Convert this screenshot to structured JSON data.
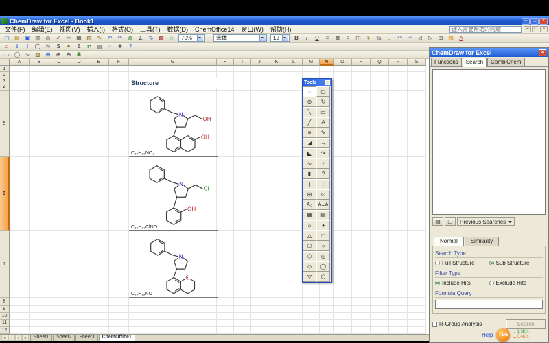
{
  "window": {
    "title": "ChemDraw for Excel - Book1",
    "buttons": [
      {
        "name": "minimize-button",
        "glyph": "─"
      },
      {
        "name": "restore-button",
        "glyph": "□"
      },
      {
        "name": "close-button",
        "glyph": "×",
        "cls": "close"
      }
    ]
  },
  "menu": {
    "items": [
      {
        "name": "menu-file",
        "label": "文件(F)"
      },
      {
        "name": "menu-edit",
        "label": "编辑(E)"
      },
      {
        "name": "menu-view",
        "label": "视图(V)"
      },
      {
        "name": "menu-insert",
        "label": "插入(I)"
      },
      {
        "name": "menu-format",
        "label": "格式(O)"
      },
      {
        "name": "menu-tools",
        "label": "工具(T)"
      },
      {
        "name": "menu-data",
        "label": "数据(D)"
      },
      {
        "name": "menu-chemoffice",
        "label": "ChemOffice14"
      },
      {
        "name": "menu-window",
        "label": "窗口(W)"
      },
      {
        "name": "menu-help",
        "label": "帮助(H)"
      }
    ],
    "help_placeholder": "键入需要帮助的问题",
    "book_controls": [
      {
        "name": "book-minimize-button",
        "glyph": "─"
      },
      {
        "name": "book-restore-button",
        "glyph": "□"
      },
      {
        "name": "book-close-button",
        "glyph": "×"
      }
    ]
  },
  "toolbars": {
    "standard": [
      {
        "name": "new-workbook-icon",
        "glyph": "▢",
        "color": "#2a5bd7"
      },
      {
        "name": "open-icon",
        "glyph": "▤",
        "color": "#b8860b"
      },
      {
        "name": "save-icon",
        "glyph": "▣",
        "color": "#2a5bd7"
      },
      {
        "name": "print-icon",
        "glyph": "▥",
        "color": "#555"
      },
      {
        "name": "print-preview-icon",
        "glyph": "◎",
        "color": "#555"
      },
      {
        "name": "spelling-icon",
        "glyph": "✓",
        "color": "#a33"
      },
      {
        "name": "cut-icon",
        "glyph": "✂",
        "color": "#555"
      },
      {
        "name": "copy-icon",
        "glyph": "▦",
        "color": "#555"
      },
      {
        "name": "paste-icon",
        "glyph": "▧",
        "color": "#8a6d1a"
      },
      {
        "name": "format-painter-icon",
        "glyph": "✎",
        "color": "#8a6d1a"
      },
      {
        "name": "undo-icon",
        "glyph": "↶",
        "color": "#2a5bd7"
      },
      {
        "name": "redo-icon",
        "glyph": "↷",
        "color": "#2a5bd7"
      },
      {
        "name": "hyperlink-icon",
        "glyph": "◍",
        "color": "#2a7a2a"
      },
      {
        "name": "autosum-icon",
        "glyph": "Σ",
        "color": "#333"
      },
      {
        "name": "sort-ascending-icon",
        "glyph": "⇅",
        "color": "#2a5bd7"
      },
      {
        "name": "chart-wizard-icon",
        "glyph": "▩",
        "color": "#a33"
      },
      {
        "name": "drawing-icon",
        "glyph": "◇",
        "color": "#3a7"
      }
    ],
    "zoom_value": "70%",
    "font_name": "宋体",
    "font_size": "12",
    "formatting": [
      {
        "name": "bold-icon",
        "glyph": "B",
        "cls": "b"
      },
      {
        "name": "italic-icon",
        "glyph": "I",
        "cls": "i"
      },
      {
        "name": "underline-icon",
        "glyph": "U",
        "cls": "u"
      },
      {
        "name": "align-left-icon",
        "glyph": "≡"
      },
      {
        "name": "align-center-icon",
        "glyph": "≣"
      },
      {
        "name": "align-right-icon",
        "glyph": "≡"
      },
      {
        "name": "merge-center-icon",
        "glyph": "◫"
      },
      {
        "name": "currency-icon",
        "glyph": "¥",
        "color": "#8a6d1a"
      },
      {
        "name": "percent-icon",
        "glyph": "%"
      },
      {
        "name": "comma-icon",
        "glyph": ","
      },
      {
        "name": "increase-decimal-icon",
        "glyph": "⁺⁰",
        "color": "#2a5bd7"
      },
      {
        "name": "decrease-decimal-icon",
        "glyph": "⁻⁰",
        "color": "#2a5bd7"
      },
      {
        "name": "decrease-indent-icon",
        "glyph": "◁"
      },
      {
        "name": "increase-indent-icon",
        "glyph": "▷"
      },
      {
        "name": "borders-icon",
        "glyph": "⊞"
      },
      {
        "name": "fill-color-icon",
        "glyph": "▨",
        "color": "#e08a00"
      },
      {
        "name": "font-color-icon",
        "glyph": "A",
        "cls": "u",
        "color": "#c03030"
      }
    ],
    "chem": [
      {
        "name": "chemdraw-icon",
        "glyph": "⌂",
        "color": "#c0392b"
      },
      {
        "name": "import-table-icon",
        "glyph": "⇓",
        "color": "#2a5bd7"
      },
      {
        "name": "export-table-icon",
        "glyph": "⇑",
        "color": "#2a5bd7"
      },
      {
        "name": "add-structure-icon",
        "glyph": "◯",
        "color": "#333"
      },
      {
        "name": "name-to-structure-icon",
        "glyph": "N",
        "color": "#333"
      },
      {
        "name": "structure-to-name-icon",
        "glyph": "S",
        "color": "#333"
      },
      {
        "name": "clean-structure-icon",
        "glyph": "✦",
        "color": "#8a6d1a"
      },
      {
        "name": "analyze-structure-icon",
        "glyph": "Σ",
        "color": "#333"
      },
      {
        "name": "convert-icon",
        "glyph": "⇄",
        "color": "#2a7a2a"
      },
      {
        "name": "database-icon",
        "glyph": "▤",
        "color": "#666"
      },
      {
        "name": "search-structure-icon",
        "glyph": "◌",
        "color": "#333"
      },
      {
        "name": "settings-icon",
        "glyph": "✱",
        "color": "#666"
      },
      {
        "name": "chem-help-icon",
        "glyph": "?",
        "color": "#2a5bd7"
      }
    ],
    "chem2": [
      {
        "name": "load-template-icon",
        "glyph": "▭",
        "color": "#555"
      },
      {
        "name": "ring-tool-icon",
        "glyph": "◯",
        "color": "#555"
      },
      {
        "name": "chain-tool-icon",
        "glyph": "∿",
        "color": "#555"
      },
      {
        "name": "paste-special-icon",
        "glyph": "▧",
        "color": "#8a6d1a"
      },
      {
        "name": "view-datasheet-icon",
        "glyph": "⊞",
        "color": "#2a5bd7"
      },
      {
        "name": "zoom-in-icon",
        "glyph": "⊕",
        "color": "#333"
      },
      {
        "name": "zoom-out-icon",
        "glyph": "⊖",
        "color": "#333"
      },
      {
        "name": "options-icon",
        "glyph": "✱",
        "color": "#2a7a2a"
      }
    ]
  },
  "grid": {
    "columns": [
      {
        "label": "A",
        "w": 29
      },
      {
        "label": "B",
        "w": 29
      },
      {
        "label": "C",
        "w": 29
      },
      {
        "label": "D",
        "w": 29
      },
      {
        "label": "E",
        "w": 29
      },
      {
        "label": "F",
        "w": 29
      },
      {
        "label": "G",
        "w": 128
      },
      {
        "label": "H",
        "w": 25
      },
      {
        "label": "I",
        "w": 25
      },
      {
        "label": "J",
        "w": 25
      },
      {
        "label": "K",
        "w": 25
      },
      {
        "label": "L",
        "w": 25
      },
      {
        "label": "M",
        "w": 25
      },
      {
        "label": "N",
        "w": 20,
        "selected": true
      },
      {
        "label": "O",
        "w": 27
      },
      {
        "label": "P",
        "w": 27
      },
      {
        "label": "Q",
        "w": 27
      },
      {
        "label": "R",
        "w": 27
      },
      {
        "label": "S",
        "w": 27
      }
    ],
    "rows": [
      {
        "label": "1",
        "h": 9
      },
      {
        "label": "2",
        "h": 9
      },
      {
        "label": "3",
        "h": 9
      },
      {
        "label": "4",
        "h": 9
      },
      {
        "label": "5",
        "h": 97
      },
      {
        "label": "6",
        "h": 108,
        "selected": true
      },
      {
        "label": "7",
        "h": 97
      },
      {
        "label": "8",
        "h": 12
      },
      {
        "label": "9",
        "h": 10
      },
      {
        "label": "10",
        "h": 10
      },
      {
        "label": "11",
        "h": 10
      },
      {
        "label": "12",
        "h": 11
      }
    ]
  },
  "sheet": {
    "structure_header": "Structure",
    "structures": [
      {
        "formula": "C₁₉H₂₃NO₂",
        "atoms": [
          "N",
          "OH",
          "OH"
        ]
      },
      {
        "formula": "C₁₈H₂₀ClNO",
        "atoms": [
          "N",
          "Cl",
          "OH"
        ]
      },
      {
        "formula": "C₁₉H₁₉NO",
        "atoms": [
          "N",
          "O"
        ]
      }
    ]
  },
  "tools_palette": {
    "title": "Tools",
    "icons": [
      {
        "name": "lasso-tool-icon",
        "glyph": "◌",
        "selected": true
      },
      {
        "name": "marquee-tool-icon",
        "glyph": "▢"
      },
      {
        "name": "orbit-tool-icon",
        "glyph": "⊕"
      },
      {
        "name": "rotate-tool-icon",
        "glyph": "↻"
      },
      {
        "name": "bond-tool-icon",
        "glyph": "╲"
      },
      {
        "name": "eraser-tool-icon",
        "glyph": "▭"
      },
      {
        "name": "dashed-bond-icon",
        "glyph": "╱"
      },
      {
        "name": "text-tool-icon",
        "glyph": "A"
      },
      {
        "name": "multiple-bond-icon",
        "glyph": "≡"
      },
      {
        "name": "pencil-tool-icon",
        "glyph": "✎"
      },
      {
        "name": "wedge-bond-icon",
        "glyph": "◢"
      },
      {
        "name": "arrow-tool-icon",
        "glyph": "→"
      },
      {
        "name": "hollow-wedge-bond-icon",
        "glyph": "◣"
      },
      {
        "name": "curved-arrow-icon",
        "glyph": "↷"
      },
      {
        "name": "wavy-bond-icon",
        "glyph": "∿"
      },
      {
        "name": "charge-tool-icon",
        "glyph": "±"
      },
      {
        "name": "bold-bond-icon",
        "glyph": "▮"
      },
      {
        "name": "query-tool-icon",
        "glyph": "?"
      },
      {
        "name": "double-bond-icon",
        "glyph": "∥"
      },
      {
        "name": "bracket-tool-icon",
        "glyph": "["
      },
      {
        "name": "table-tool-icon",
        "glyph": "⊞"
      },
      {
        "name": "atom-symbol-icon",
        "glyph": "⊙"
      },
      {
        "name": "subscript-tool-icon",
        "glyph": "A₂"
      },
      {
        "name": "atom-atom-icon",
        "glyph": "A=A"
      },
      {
        "name": "grid-tool-icon",
        "glyph": "▦"
      },
      {
        "name": "clipboard-tool-icon",
        "glyph": "▤"
      },
      {
        "name": "template-tool-icon",
        "glyph": "⌂"
      },
      {
        "name": "stamp-tool-icon",
        "glyph": "♦"
      },
      {
        "name": "triangle-ring-icon",
        "glyph": "△"
      },
      {
        "name": "square-ring-icon",
        "glyph": "□"
      },
      {
        "name": "pentagon-ring-icon",
        "glyph": "⬠"
      },
      {
        "name": "circle-ring-icon",
        "glyph": "○"
      },
      {
        "name": "hexagon-ring-icon",
        "glyph": "⬡"
      },
      {
        "name": "benzene-ring-icon",
        "glyph": "◎"
      },
      {
        "name": "cyclopentane-ring-icon",
        "glyph": "◇"
      },
      {
        "name": "cyclooctane-ring-icon",
        "glyph": "◯"
      },
      {
        "name": "chair-ring-icon",
        "glyph": "▽"
      },
      {
        "name": "cycloheptane-ring-icon",
        "glyph": "⬡"
      }
    ]
  },
  "panel": {
    "title": "ChemDraw for Excel",
    "close_glyph": "×",
    "tabs": [
      {
        "name": "panel-tab-functions",
        "label": "Functions"
      },
      {
        "name": "panel-tab-search",
        "label": "Search",
        "selected": true
      },
      {
        "name": "panel-tab-combichem",
        "label": "CombiChem"
      }
    ],
    "toolbar_icons": [
      {
        "name": "save-search-icon",
        "glyph": "▤"
      },
      {
        "name": "new-search-icon",
        "glyph": "▢"
      }
    ],
    "previous_searches": "Previous Searches",
    "subtabs": [
      {
        "name": "subtab-normal",
        "label": "Normal",
        "selected": true
      },
      {
        "name": "subtab-similarity",
        "label": "Similarity"
      }
    ],
    "search_type_label": "Search Type",
    "search_type_options": [
      {
        "name": "radio-full-structure",
        "label": "Full Structure"
      },
      {
        "name": "radio-sub-structure",
        "label": "Sub Structure",
        "selected": true
      }
    ],
    "filter_type_label": "Filter Type",
    "filter_type_options": [
      {
        "name": "radio-include-hits",
        "label": "Include Hits",
        "selected": true
      },
      {
        "name": "radio-exclude-hits",
        "label": "Exclude Hits"
      }
    ],
    "formula_query_label": "Formula Query",
    "formula_query_value": "",
    "rgroup_label": "R-Group Analysis",
    "search_button": "Search",
    "help_link": "Help"
  },
  "ball": {
    "percent": "71%",
    "up": "1.3K/s",
    "down": "0.4K/s"
  },
  "sheet_tabs": {
    "nav": [
      {
        "name": "first-sheet-button",
        "glyph": "«"
      },
      {
        "name": "prev-sheet-button",
        "glyph": "‹"
      },
      {
        "name": "next-sheet-button",
        "glyph": "›"
      },
      {
        "name": "last-sheet-button",
        "glyph": "»"
      }
    ],
    "tabs": [
      {
        "name": "sheet-tab-sheet1",
        "label": "Sheet1"
      },
      {
        "name": "sheet-tab-sheet2",
        "label": "Sheet2"
      },
      {
        "name": "sheet-tab-sheet3",
        "label": "Sheet3"
      },
      {
        "name": "sheet-tab-chemoffice1",
        "label": "ChemOffice1",
        "selected": true
      }
    ]
  }
}
